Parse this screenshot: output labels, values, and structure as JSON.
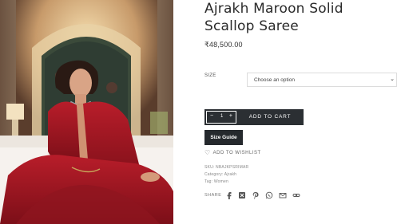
{
  "product": {
    "title": "Ajrakh Maroon Solid Scallop Saree",
    "price": "₹48,500.00",
    "image_alt": "Model wearing maroon saree"
  },
  "size": {
    "label": "SIZE",
    "selected": "Choose an option"
  },
  "cart": {
    "qty_minus": "−",
    "quantity": "1",
    "qty_plus": "+",
    "add_label": "ADD TO CART"
  },
  "size_guide": "Size Guide",
  "wishlist": "ADD TO WISHLIST",
  "meta": {
    "sku": "SKU: NBAJKPSRIMAR",
    "category": "Category: Ajrakh",
    "tag": "Tag: Women"
  },
  "share": {
    "label": "SHARE",
    "icons": [
      "facebook-icon",
      "x-icon",
      "pinterest-icon",
      "whatsapp-icon",
      "email-icon",
      "link-icon"
    ]
  },
  "colors": {
    "button_dark": "#2b2f33",
    "saree_maroon": "#9e1622"
  }
}
